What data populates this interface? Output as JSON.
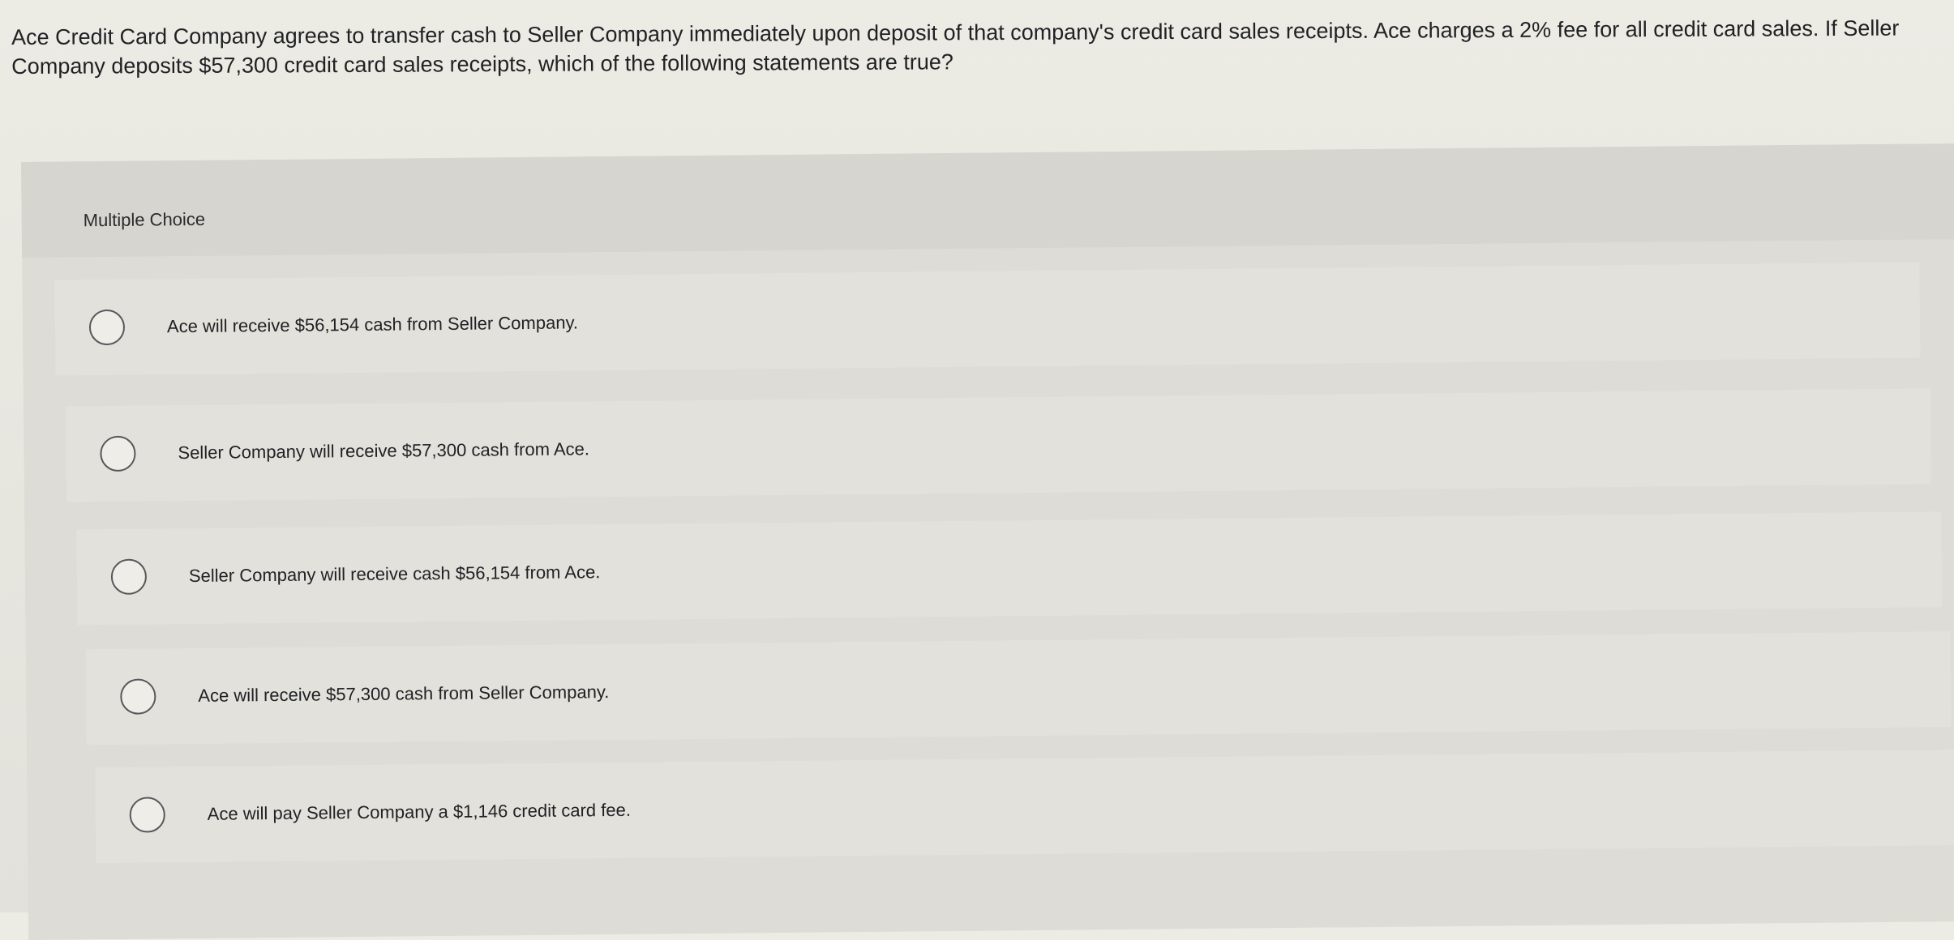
{
  "question": {
    "text": "Ace Credit Card Company agrees to transfer cash to Seller Company immediately upon deposit of that company's credit card sales receipts. Ace charges a 2% fee for all credit card sales. If Seller Company deposits $57,300 credit card sales receipts, which of the following statements are true?"
  },
  "multiple_choice": {
    "label": "Multiple Choice",
    "options": [
      {
        "text": "Ace will receive $56,154 cash from Seller Company."
      },
      {
        "text": "Seller Company will receive $57,300 cash from Ace."
      },
      {
        "text": "Seller Company will receive cash $56,154 from Ace."
      },
      {
        "text": "Ace will receive $57,300 cash from Seller Company."
      },
      {
        "text": "Ace will pay Seller Company a $1,146 credit card fee."
      }
    ]
  }
}
